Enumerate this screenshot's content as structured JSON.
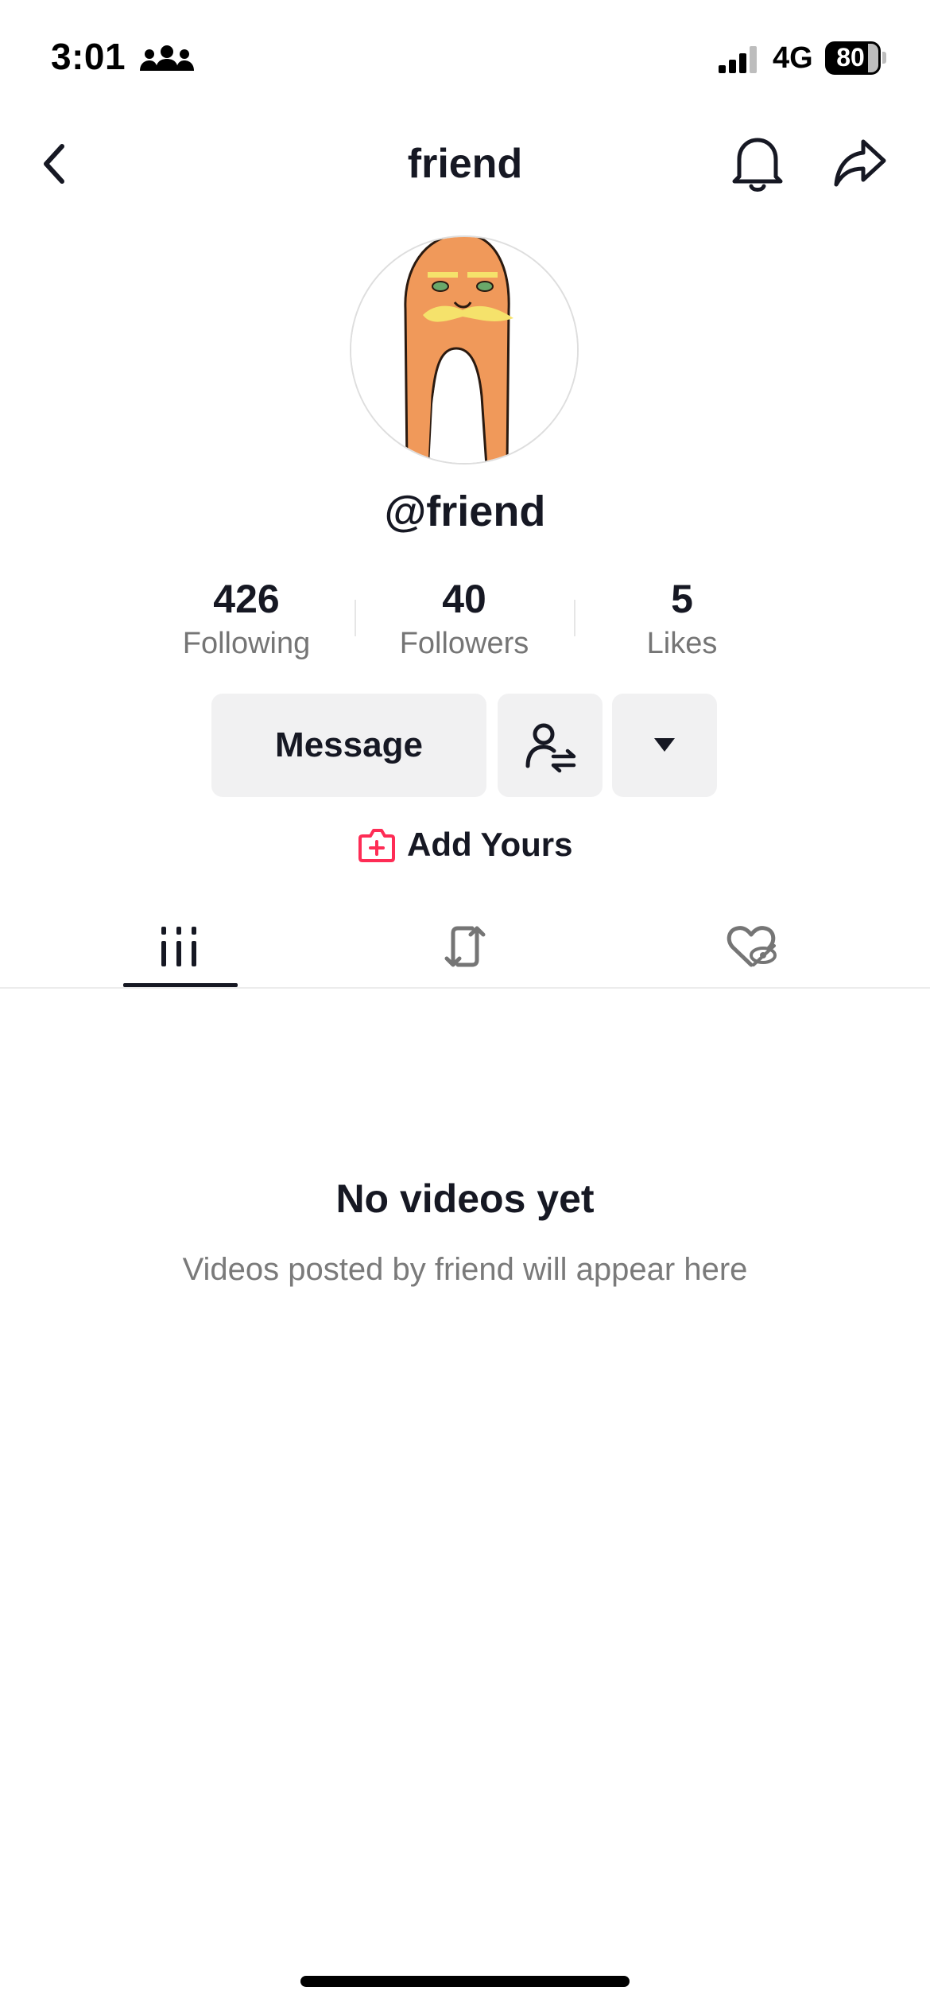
{
  "status_bar": {
    "time": "3:01",
    "network": "4G",
    "battery_percent": "80",
    "battery_level": 0.8,
    "icons": [
      "people-icon",
      "signal-icon",
      "battery-icon"
    ]
  },
  "header": {
    "title": "friend",
    "icons": [
      "back-chevron-icon",
      "bell-icon",
      "share-arrow-icon"
    ]
  },
  "profile": {
    "handle": "@friend",
    "stats": [
      {
        "value": "426",
        "label": "Following"
      },
      {
        "value": "40",
        "label": "Followers"
      },
      {
        "value": "5",
        "label": "Likes"
      }
    ]
  },
  "actions": {
    "message_label": "Message",
    "friend_icon": "user-swap-icon",
    "more_icon": "caret-down-icon",
    "add_yours_label": "Add Yours",
    "add_yours_icon": "add-yours-icon",
    "accent": "#fe2c55"
  },
  "tabs": [
    {
      "icon": "videos-grid-icon",
      "selected": true
    },
    {
      "icon": "repost-icon",
      "selected": false
    },
    {
      "icon": "liked-hidden-icon",
      "selected": false
    }
  ],
  "empty_state": {
    "title": "No videos yet",
    "subtitle": "Videos posted by friend will appear here"
  }
}
